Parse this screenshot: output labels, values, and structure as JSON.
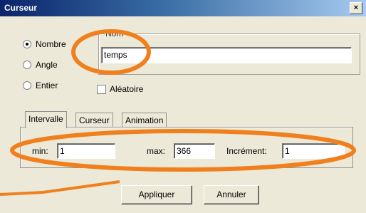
{
  "window": {
    "title": "Curseur",
    "close_label": "×"
  },
  "type_options": {
    "items": [
      {
        "label": "Nombre",
        "selected": true
      },
      {
        "label": "Angle",
        "selected": false
      },
      {
        "label": "Entier",
        "selected": false
      }
    ]
  },
  "name_group": {
    "label": "Nom",
    "value": "temps"
  },
  "random": {
    "label": "Aléatoire",
    "checked": false
  },
  "tabs": [
    {
      "label": "Intervalle",
      "active": true
    },
    {
      "label": "Curseur",
      "active": false
    },
    {
      "label": "Animation",
      "active": false
    }
  ],
  "interval": {
    "min_label": "min:",
    "min_value": "1",
    "max_label": "max:",
    "max_value": "366",
    "increment_label": "Incrément:",
    "increment_value": "1"
  },
  "buttons": {
    "apply": "Appliquer",
    "cancel": "Annuler"
  },
  "annotation_color": "#f0801e"
}
